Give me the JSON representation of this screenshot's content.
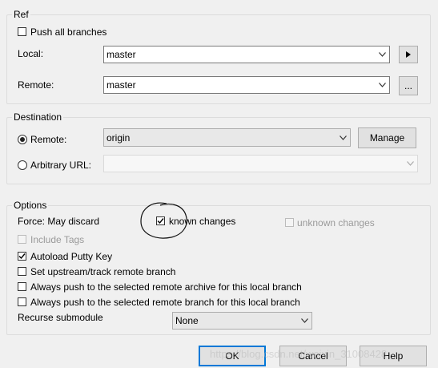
{
  "ref": {
    "legend": "Ref",
    "push_all_branches": {
      "label": "Push all branches",
      "checked": false
    },
    "local": {
      "label": "Local:",
      "value": "master"
    },
    "remote": {
      "label": "Remote:",
      "value": "master",
      "browse_label": "..."
    }
  },
  "destination": {
    "legend": "Destination",
    "remote": {
      "label": "Remote:",
      "value": "origin",
      "selected": true
    },
    "manage_label": "Manage",
    "arbitrary_url": {
      "label": "Arbitrary URL:",
      "value": "",
      "selected": false
    }
  },
  "options": {
    "legend": "Options",
    "force_label": "Force: May discard",
    "known_changes": {
      "label": "known changes",
      "checked": true
    },
    "unknown_changes": {
      "label": "unknown changes",
      "checked": false,
      "enabled": false
    },
    "include_tags": {
      "label": "Include Tags",
      "checked": false,
      "enabled": false
    },
    "autoload_putty": {
      "label": "Autoload Putty Key",
      "checked": true
    },
    "set_upstream": {
      "label": "Set upstream/track remote branch",
      "checked": false
    },
    "push_remote_archive": {
      "label": "Always push to the selected remote archive for this local branch",
      "checked": false
    },
    "push_remote_branch": {
      "label": "Always push to the selected remote branch for this local branch",
      "checked": false
    },
    "recurse_submodule": {
      "label": "Recurse submodule",
      "value": "None"
    }
  },
  "buttons": {
    "ok": "OK",
    "cancel": "Cancel",
    "help": "Help"
  },
  "watermark": "https://blog.csdn.net/weixin_31008428",
  "colors": {
    "focus_border": "#0078d7",
    "annotation": "#000000"
  }
}
